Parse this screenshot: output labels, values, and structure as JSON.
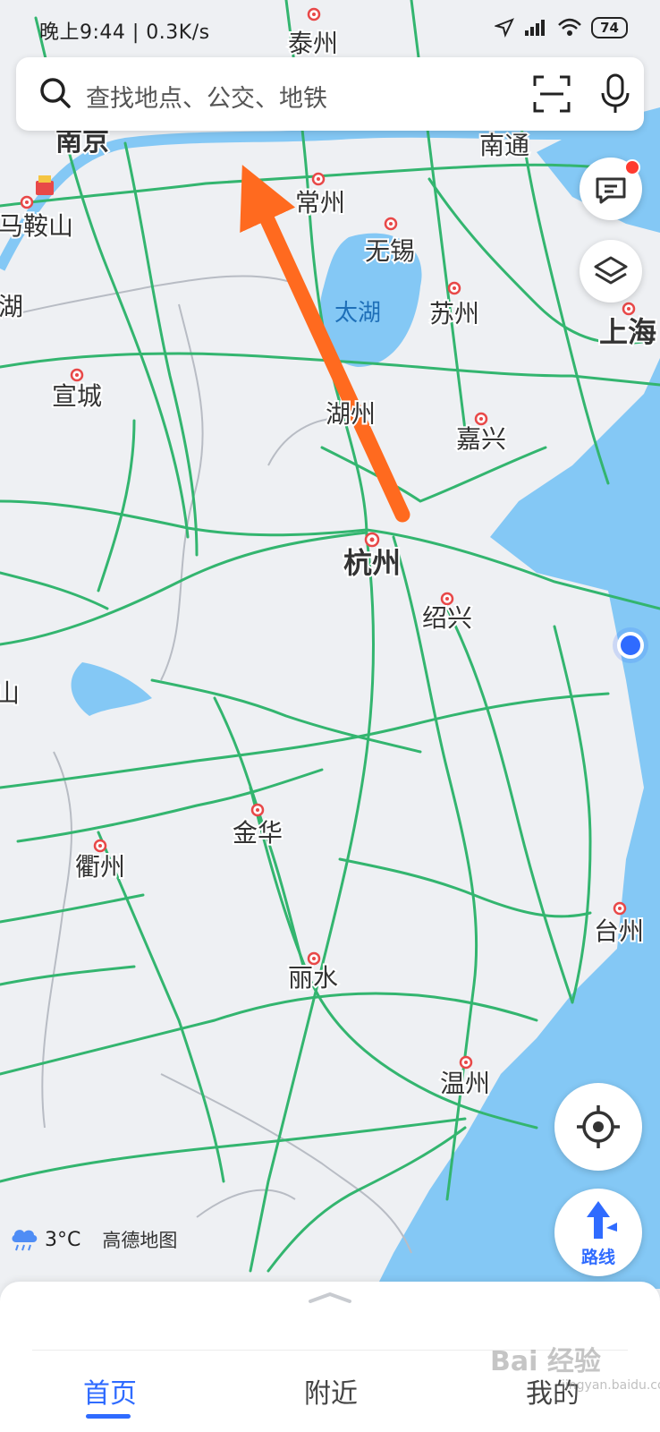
{
  "status_bar": {
    "left_text": "晚上9:44 | 0.3K/s",
    "battery": "74"
  },
  "search": {
    "placeholder": "查找地点、公交、地铁"
  },
  "map": {
    "cities": [
      {
        "name": "泰州",
        "major": false
      },
      {
        "name": "南京",
        "major": true
      },
      {
        "name": "南通",
        "major": false
      },
      {
        "name": "常州",
        "major": false
      },
      {
        "name": "马鞍山",
        "major": false
      },
      {
        "name": "无锡",
        "major": false
      },
      {
        "name": "苏州",
        "major": false
      },
      {
        "name": "上海",
        "major": true
      },
      {
        "name": "湖",
        "major": false
      },
      {
        "name": "宣城",
        "major": false
      },
      {
        "name": "湖州",
        "major": false
      },
      {
        "name": "嘉兴",
        "major": false
      },
      {
        "name": "杭州",
        "major": true
      },
      {
        "name": "绍兴",
        "major": false
      },
      {
        "name": "山",
        "major": false
      },
      {
        "name": "金华",
        "major": false
      },
      {
        "name": "衢州",
        "major": false
      },
      {
        "name": "台州",
        "major": false
      },
      {
        "name": "丽水",
        "major": false
      },
      {
        "name": "温州",
        "major": false
      }
    ],
    "lake_label": "太湖",
    "water_color": "#84c8f5",
    "road_color": "#33b56f",
    "annotation_color": "#ff6a1f"
  },
  "weather": {
    "temperature": "3°C",
    "icon": "rain-cloud-icon",
    "map_logo": "高德地图"
  },
  "route_button": {
    "label": "路线"
  },
  "tabs": [
    {
      "label": "首页",
      "active": true
    },
    {
      "label": "附近",
      "active": false
    },
    {
      "label": "我的",
      "active": false
    }
  ],
  "watermark": {
    "text": "Bai 经验",
    "sub": "jingyan.baidu.com"
  }
}
